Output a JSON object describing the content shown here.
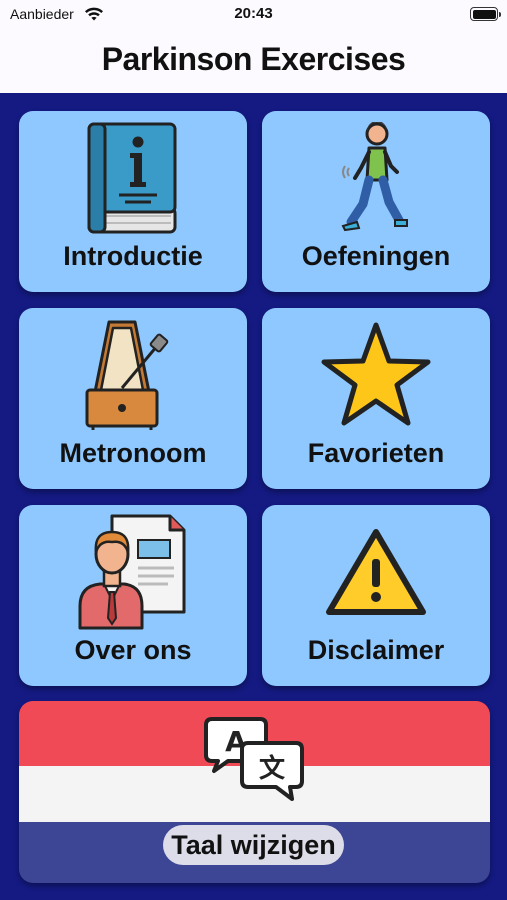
{
  "status_bar": {
    "carrier": "Aanbieder",
    "time": "20:43"
  },
  "header": {
    "title": "Parkinson Exercises"
  },
  "tiles": [
    {
      "label": "Introductie",
      "icon": "info-book-icon"
    },
    {
      "label": "Oefeningen",
      "icon": "walking-person-icon"
    },
    {
      "label": "Metronoom",
      "icon": "metronome-icon"
    },
    {
      "label": "Favorieten",
      "icon": "star-icon"
    },
    {
      "label": "Over ons",
      "icon": "person-document-icon"
    },
    {
      "label": "Disclaimer",
      "icon": "warning-icon"
    }
  ],
  "language_tile": {
    "label": "Taal wijzigen",
    "icon": "translate-icon"
  },
  "colors": {
    "header_bg": "#fdfaff",
    "main_bg": "#141a82",
    "tile_bg": "#8ec8ff",
    "flag_red": "#f04a56",
    "flag_white": "#f4f4f4",
    "flag_blue": "#3d4595"
  }
}
